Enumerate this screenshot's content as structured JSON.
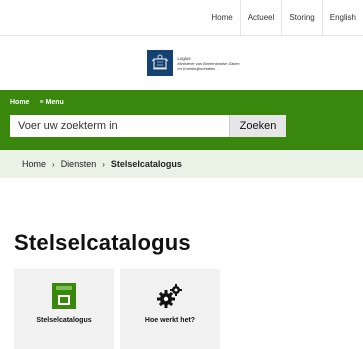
{
  "topnav": [
    "Home",
    "Actueel",
    "Storing",
    "English"
  ],
  "logo": {
    "line1": "Logius",
    "line2": "Ministerie van Binnenlandse Zaken",
    "line3": "en Koninkrijksrelaties"
  },
  "menu": {
    "home": "Home",
    "menu": "≡ Menu"
  },
  "search": {
    "placeholder": "Voer uw zoekterm in",
    "button": "Zoeken"
  },
  "breadcrumb": {
    "home": "Home",
    "sep": "›",
    "diensten": "Diensten",
    "current": "Stelselcatalogus"
  },
  "page": {
    "title": "Stelselcatalogus"
  },
  "tiles": [
    {
      "label": "Stelselcatalogus",
      "icon": "catalog-icon"
    },
    {
      "label": "Hoe werkt het?",
      "icon": "gears-icon"
    }
  ],
  "colors": {
    "green": "#39870c",
    "logo_blue": "#154273",
    "crumb_bg": "#eaf2e6",
    "tile_bg": "#f1f1f1"
  }
}
